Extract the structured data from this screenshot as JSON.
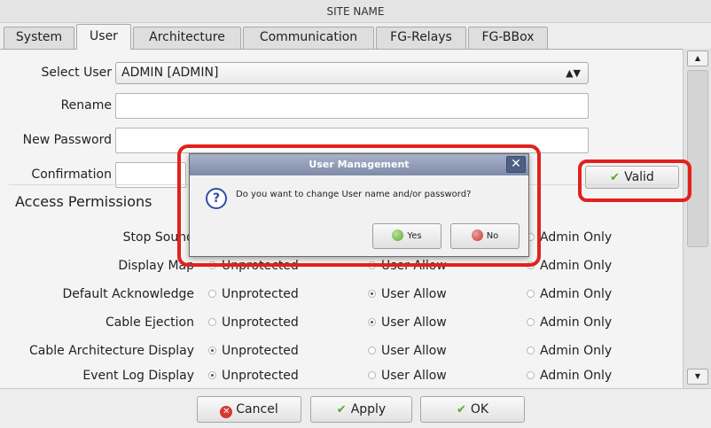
{
  "window": {
    "title": "SITE NAME"
  },
  "tabs": [
    {
      "label": "System",
      "active": false
    },
    {
      "label": "User",
      "active": true
    },
    {
      "label": "Architecture",
      "active": false
    },
    {
      "label": "Communication",
      "active": false
    },
    {
      "label": "FG-Relays",
      "active": false
    },
    {
      "label": "FG-BBox",
      "active": false
    }
  ],
  "form": {
    "select_user_label": "Select User",
    "select_user_value": "ADMIN [ADMIN]",
    "rename_label": "Rename",
    "rename_value": "",
    "new_password_label": "New Password",
    "new_password_value": "",
    "confirmation_label": "Confirmation",
    "confirmation_value": "",
    "valid_button": "Valid"
  },
  "access": {
    "title": "Access Permissions",
    "options": [
      "Unprotected",
      "User Allow",
      "Admin Only"
    ],
    "rows": [
      {
        "label": "Stop Sound",
        "selected": null
      },
      {
        "label": "Display Map",
        "selected": "Unprotected"
      },
      {
        "label": "Default Acknowledge",
        "selected": "User Allow"
      },
      {
        "label": "Cable Ejection",
        "selected": "User Allow"
      },
      {
        "label": "Cable Architecture Display",
        "selected": "Unprotected"
      },
      {
        "label": "Event Log Display",
        "selected": "Unprotected"
      }
    ]
  },
  "dialog": {
    "title": "User Management",
    "message": "Do you want to change User name and/or password?",
    "yes_label": "Yes",
    "no_label": "No"
  },
  "bottom": {
    "cancel_label": "Cancel",
    "apply_label": "Apply",
    "ok_label": "OK"
  },
  "colors": {
    "highlight": "#e2211c",
    "dialog_title_bar": "#7d8aa8",
    "check_green": "#58a82a"
  }
}
